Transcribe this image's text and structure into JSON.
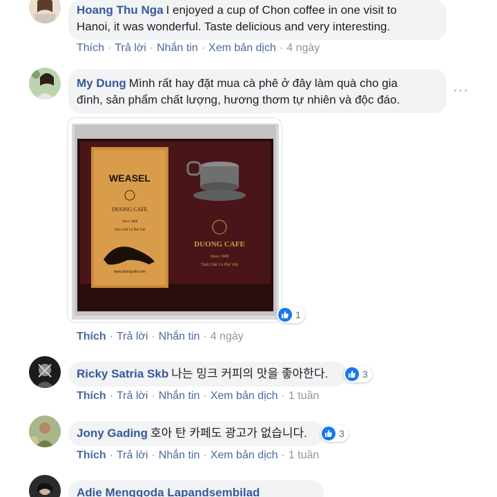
{
  "comments": [
    {
      "author": "Hoang Thu Nga",
      "text_line1": "I enjoyed a cup of Chon coffee in one visit to",
      "text_line2": "Hanoi, it was wonderful. Taste delicious and very interesting.",
      "actions": {
        "like": "Thích",
        "reply": "Trả lời",
        "message": "Nhắn tin",
        "translate": "Xem bản dịch",
        "time": "4 ngày"
      }
    },
    {
      "author": "My Dung",
      "text_line1": "Mình rất hay đặt mua cà phê ở đây làm quà cho gia",
      "text_line2": "đình, sản phẩm chất lượng, hương thơm tự nhiên và độc đáo.",
      "more_label": "···",
      "image": {
        "bag_title": "WEASEL",
        "bag_brand": "DUONG CAFE",
        "bag_since": "Since 1988",
        "bag_tagline": "Tinh Chất Cà Phê Việt",
        "bag_url": "www.duongcafe.com",
        "box_brand": "DUONG CAFE",
        "box_since": "Since 1988",
        "box_tagline": "Tinh Chất Cà Phê Việt"
      },
      "reactions": "1",
      "actions": {
        "like": "Thích",
        "reply": "Trả lời",
        "message": "Nhắn tin",
        "time": "4 ngày"
      }
    },
    {
      "author": "Ricky Satria Skb",
      "text": "나는 밍크 커피의 맛을 좋아한다.",
      "reactions": "3",
      "actions": {
        "like": "Thích",
        "reply": "Trả lời",
        "message": "Nhắn tin",
        "translate": "Xem bản dịch",
        "time": "1 tuần"
      }
    },
    {
      "author": "Jony Gading",
      "text": "호아 탄 카페도 광고가 없습니다.",
      "reactions": "3",
      "actions": {
        "like": "Thích",
        "reply": "Trả lời",
        "message": "Nhắn tin",
        "translate": "Xem bản dịch",
        "time": "1 tuần"
      }
    },
    {
      "author": "Adie Menggoda Lapandsembilad"
    }
  ],
  "colors": {
    "link": "#365899",
    "bubble": "#f2f3f5",
    "like_blue": "#1877f2",
    "meta": "#90949c"
  }
}
